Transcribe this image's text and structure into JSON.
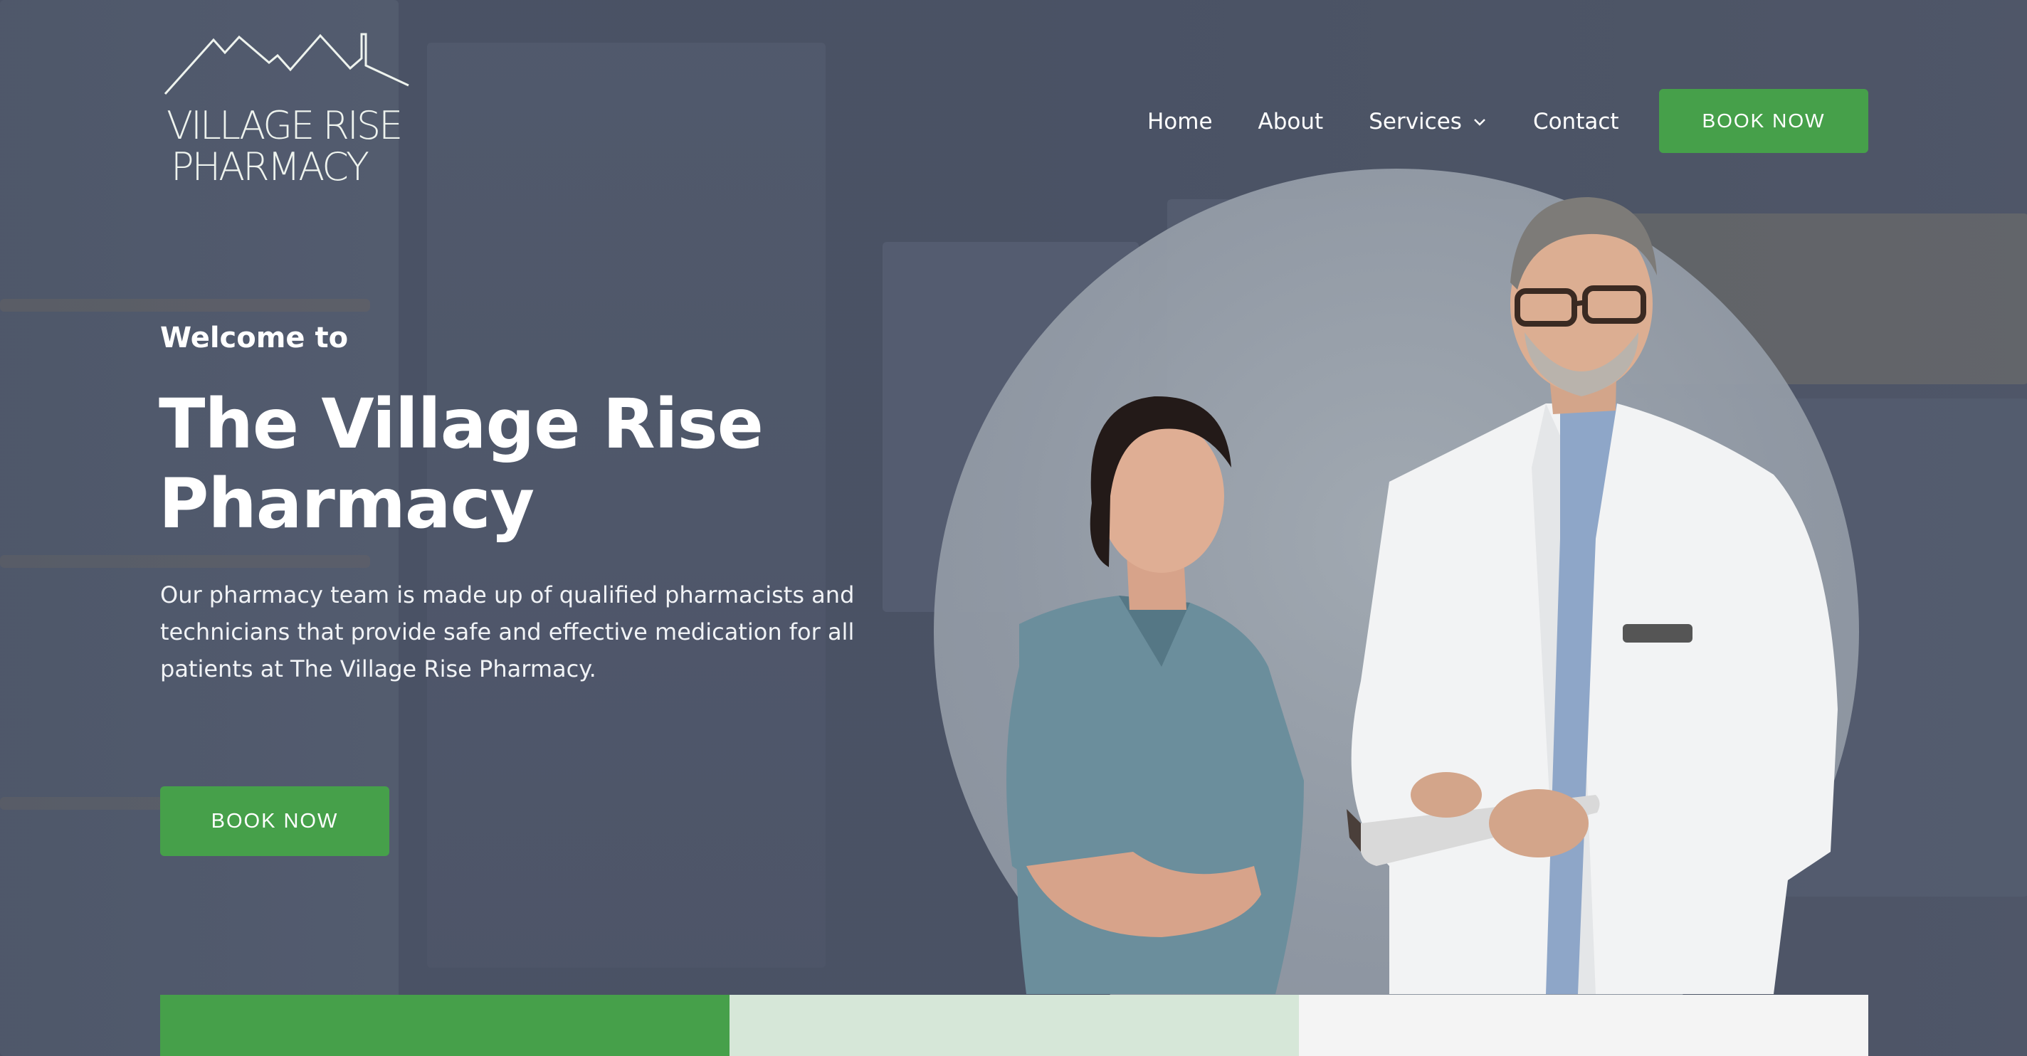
{
  "logo": {
    "line1": "VILLAGE RISE",
    "line2": "PHARMACY"
  },
  "nav": {
    "items": [
      {
        "label": "Home"
      },
      {
        "label": "About"
      },
      {
        "label": "Services"
      },
      {
        "label": "Contact"
      }
    ],
    "cta_label": "BOOK NOW"
  },
  "hero": {
    "welcome": "Welcome to",
    "title": "The Village Rise Pharmacy",
    "description": "Our pharmacy team is made up of qualified pharmacists and technicians that provide safe and effective medication for all patients at The Village Rise Pharmacy.",
    "cta_label": "BOOK NOW"
  },
  "colors": {
    "accent": "#46a04a",
    "overlay": "#4f576a",
    "bar_1": "#46a04a",
    "bar_2": "#d6e7d8",
    "bar_3": "#f4f4f4"
  },
  "icons": {
    "logo_roof": "house-roofline-icon",
    "services_chevron": "chevron-down-icon"
  }
}
